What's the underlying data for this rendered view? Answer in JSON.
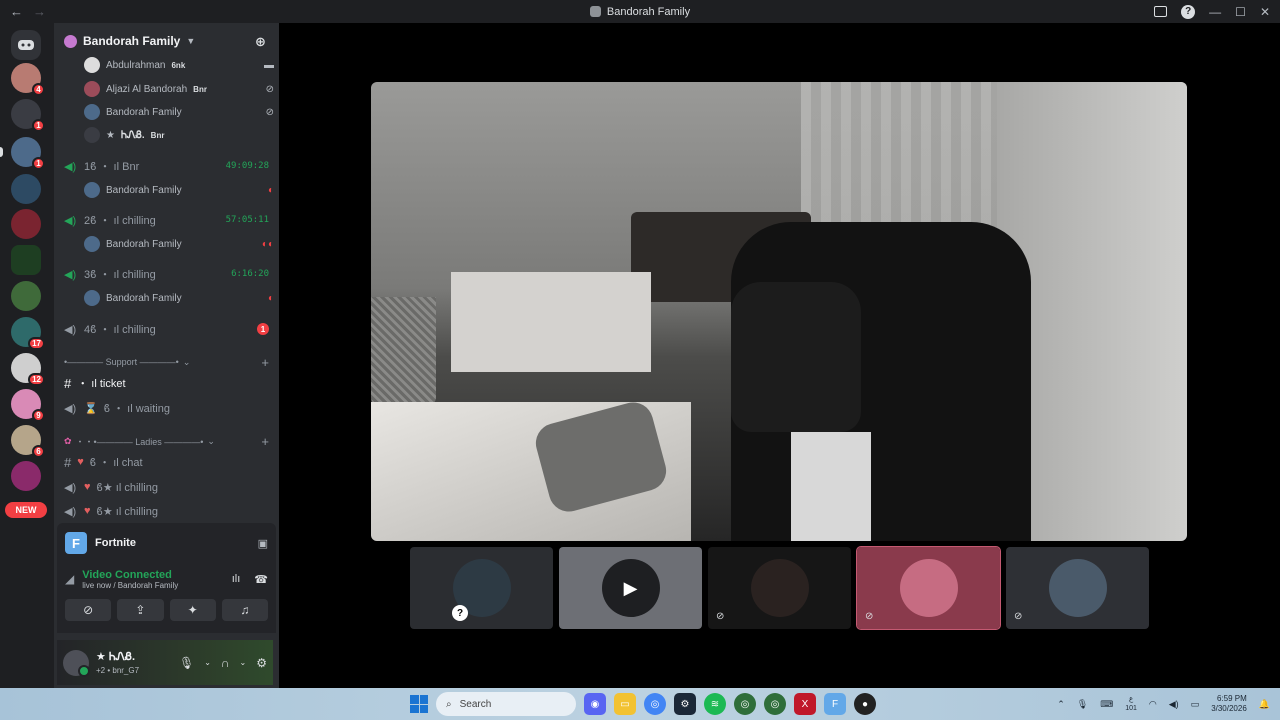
{
  "window": {
    "title": "Bandorah Family"
  },
  "servers": {
    "badges": [
      "4",
      "1",
      "1",
      "17",
      "12",
      "9",
      "6"
    ],
    "new_label": "NEW"
  },
  "guild": {
    "name": "Bandorah Family"
  },
  "voice_users_top": [
    {
      "name": "Abdulrahman",
      "tag": "6nk",
      "status_icon": "camera-icon"
    },
    {
      "name": "Aljazi Al Bandorah",
      "tag": "Bnr",
      "status_icon": "mute-icon"
    },
    {
      "name": "Bandorah Family",
      "tag": "",
      "status_icon": "stream-off-icon"
    },
    {
      "name": "ᏂᏁᏰ.",
      "tag": "Bnr",
      "prefix": "★",
      "status_icon": ""
    }
  ],
  "channels": [
    {
      "name": "1ϐ ・ ıl Bnr",
      "timer": "49:09:28",
      "user": "Bandorah Family"
    },
    {
      "name": "2ϐ ・ ıl chilling",
      "timer": "57:05:11",
      "user": "Bandorah Family"
    },
    {
      "name": "3ϐ ・ ıl chilling",
      "timer": "6:16:20",
      "user": "Bandorah Family"
    },
    {
      "name": "4ϐ ・ ıl chilling",
      "unread": "1"
    }
  ],
  "categories": {
    "support": "•———— Support ————•",
    "ladies": "・・•———— Ladies ————•"
  },
  "support_channels": [
    {
      "name": "・ ıl ticket"
    },
    {
      "name": "ϐ ・ ıl waiting"
    }
  ],
  "ladies_channels": [
    {
      "name": "ϐ ・ ıl chat"
    },
    {
      "name": "ϐ★ ıl chilling"
    },
    {
      "name": "ϐ★ ıl chilling"
    }
  ],
  "panel": {
    "activity": "Fortnite",
    "status": "Video Connected",
    "substatus": "live now / Bandorah Family"
  },
  "user": {
    "name": "ᏂᏁᏰ.",
    "prefix": "★",
    "subline": "+2 • bnr_G7"
  },
  "taskbar": {
    "search_placeholder": "Search",
    "lang_top": "ع",
    "lang_bottom": "101",
    "time": "6:59 PM",
    "date": "3/30/2026"
  },
  "colors": {
    "accent_green": "#23a559",
    "danger_red": "#f23f43",
    "sidebar_bg": "#2b2d31"
  }
}
